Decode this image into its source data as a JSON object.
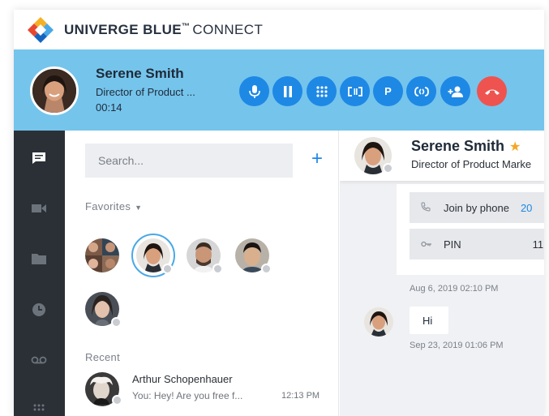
{
  "app": {
    "brand_bold": "UNIVERGE BLUE",
    "brand_tm": "™",
    "brand_thin": "CONNECT"
  },
  "call": {
    "name": "Serene Smith",
    "title": "Director of Product ...",
    "duration": "00:14",
    "controls": [
      {
        "name": "mute",
        "icon": "microphone-icon"
      },
      {
        "name": "hold",
        "icon": "pause-icon"
      },
      {
        "name": "keypad",
        "icon": "dialpad-icon"
      },
      {
        "name": "transfer",
        "icon": "transfer-icon"
      },
      {
        "name": "park",
        "label": "P",
        "icon": "park-icon"
      },
      {
        "name": "conference",
        "icon": "merge-calls-icon"
      },
      {
        "name": "add-participant",
        "icon": "add-user-icon"
      },
      {
        "name": "end-call",
        "icon": "hang-up-icon"
      }
    ],
    "accent": "#1e88e5",
    "end_color": "#ef5350",
    "bar_color": "#75c4ec"
  },
  "rail": {
    "items": [
      "chat-icon",
      "video-icon",
      "folder-icon",
      "history-icon",
      "voicemail-icon",
      "apps-grid-icon"
    ]
  },
  "contacts": {
    "search_placeholder": "Search...",
    "add_label": "+",
    "favorites_label": "Favorites",
    "recent_label": "Recent",
    "recent": [
      {
        "name": "Arthur Schopenhauer",
        "preview": "You: Hey! Are you free f...",
        "time": "12:13 PM"
      }
    ]
  },
  "chat": {
    "name": "Serene Smith",
    "title": "Director of Product Marke",
    "join_by_phone_label": "Join by phone",
    "join_by_phone_value": "20",
    "pin_label": "PIN",
    "pin_value": "11",
    "card_timestamp": "Aug 6, 2019 02:10 PM",
    "message_text": "Hi",
    "message_timestamp": "Sep 23, 2019 01:06 PM"
  }
}
